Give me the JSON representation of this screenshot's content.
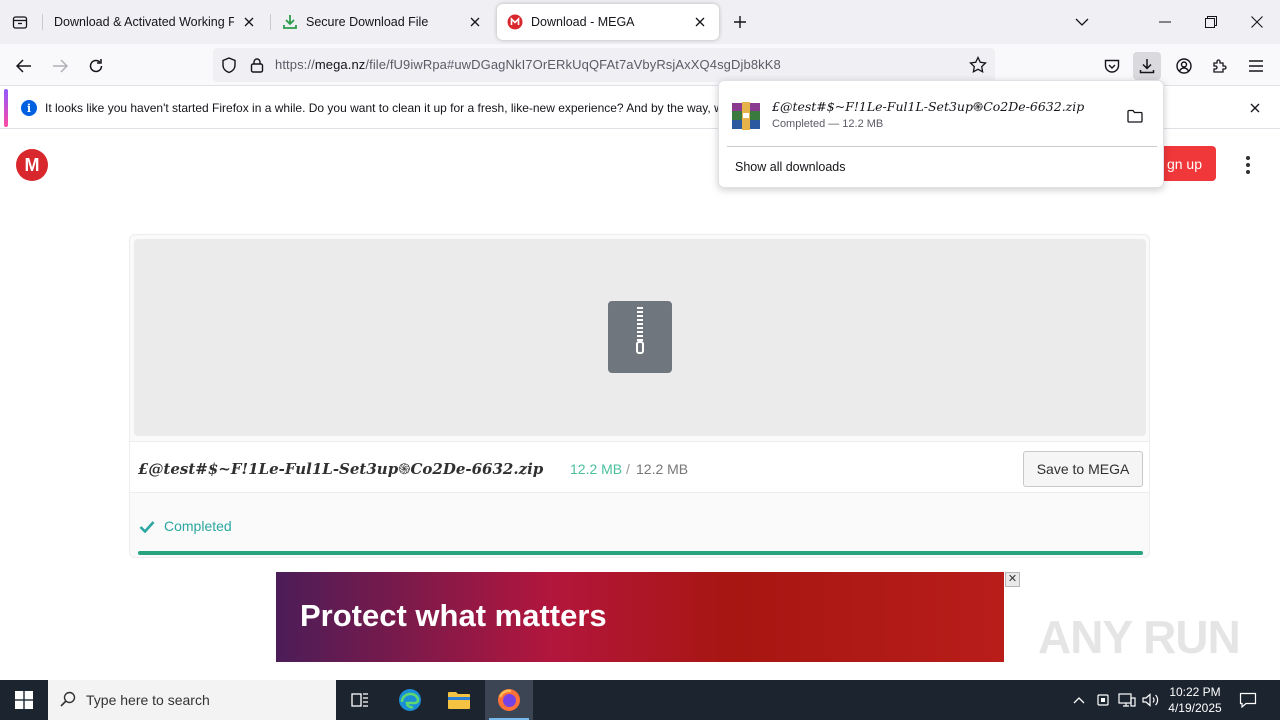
{
  "browser": {
    "tabs": [
      {
        "title": "Download & Activated Working Full",
        "active": false
      },
      {
        "title": "Secure Download File",
        "active": false
      },
      {
        "title": "Download - MEGA",
        "active": true
      }
    ],
    "url": {
      "prefix": "https://",
      "host": "mega.nz",
      "path": "/file/fU9iwRpa#uwDGagNkI7OrERkUqQFAt7aVbyRsjAxXQ4sgDjb8kK8"
    }
  },
  "notification": {
    "text": "It looks like you haven't started Firefox in a while. Do you want to clean it up for a fresh, like-new experience? And by the way, w"
  },
  "download_panel": {
    "filename_deco": "£@test#$~F!1Le-Ful1L-Set3up",
    "filename_symbol": "֍",
    "filename_rest": "Co2De-6632.zip",
    "status": "Completed — 12.2 MB",
    "show_all": "Show all downloads"
  },
  "mega": {
    "logo": "M",
    "signup_label": "gn up",
    "file": {
      "name_deco": "£@test#$~F!1Le-Ful1L-Set3up",
      "name_symbol": "֍",
      "name_rest": "Co2De-6632.zip",
      "downloaded": "12.2 MB",
      "separator": "/",
      "total": "12.2 MB"
    },
    "save_label": "Save to MEGA",
    "status": "Completed",
    "progress": 1.0
  },
  "ad": {
    "headline": "Protect what matters",
    "close": "✕"
  },
  "watermark": "ANY RUN",
  "taskbar": {
    "search_placeholder": "Type here to search",
    "time": "10:22 PM",
    "date": "4/19/2025"
  },
  "colors": {
    "mega_red": "#d9272e",
    "progress_green": "#27a37f",
    "status_teal": "#2ba6a0"
  }
}
